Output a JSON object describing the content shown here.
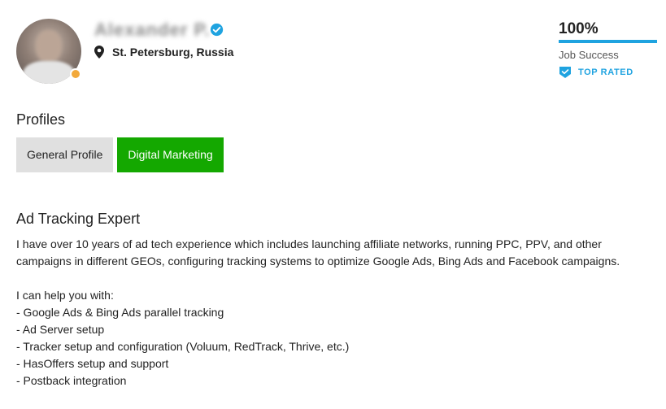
{
  "profile": {
    "name": "Alexander P.",
    "location": "St. Petersburg, Russia",
    "job_success_percent": "100%",
    "job_success_label": "Job Success",
    "badge": "TOP RATED"
  },
  "profiles_section": {
    "title": "Profiles",
    "tabs": [
      {
        "label": "General Profile",
        "active": false
      },
      {
        "label": "Digital Marketing",
        "active": true
      }
    ]
  },
  "overview": {
    "title": "Ad Tracking Expert",
    "intro": "I have over 10 years of ad tech experience which includes launching affiliate networks, running PPC, PPV, and other campaigns in different GEOs, configuring tracking systems to optimize Google Ads, Bing Ads and Facebook campaigns.",
    "help_heading": "I can help you with:",
    "items": [
      "- Google Ads & Bing Ads parallel tracking",
      "- Ad Server setup",
      "- Tracker setup and configuration (Voluum, RedTrack, Thrive, etc.)",
      "- HasOffers setup and support",
      "- Postback integration"
    ]
  },
  "colors": {
    "accent_green": "#14a800",
    "accent_blue": "#1fa3e0",
    "tab_inactive_bg": "#e0e0e0"
  },
  "icons": {
    "verified": "verified-check-icon",
    "location": "map-pin-icon",
    "top_rated": "shield-badge-icon"
  }
}
